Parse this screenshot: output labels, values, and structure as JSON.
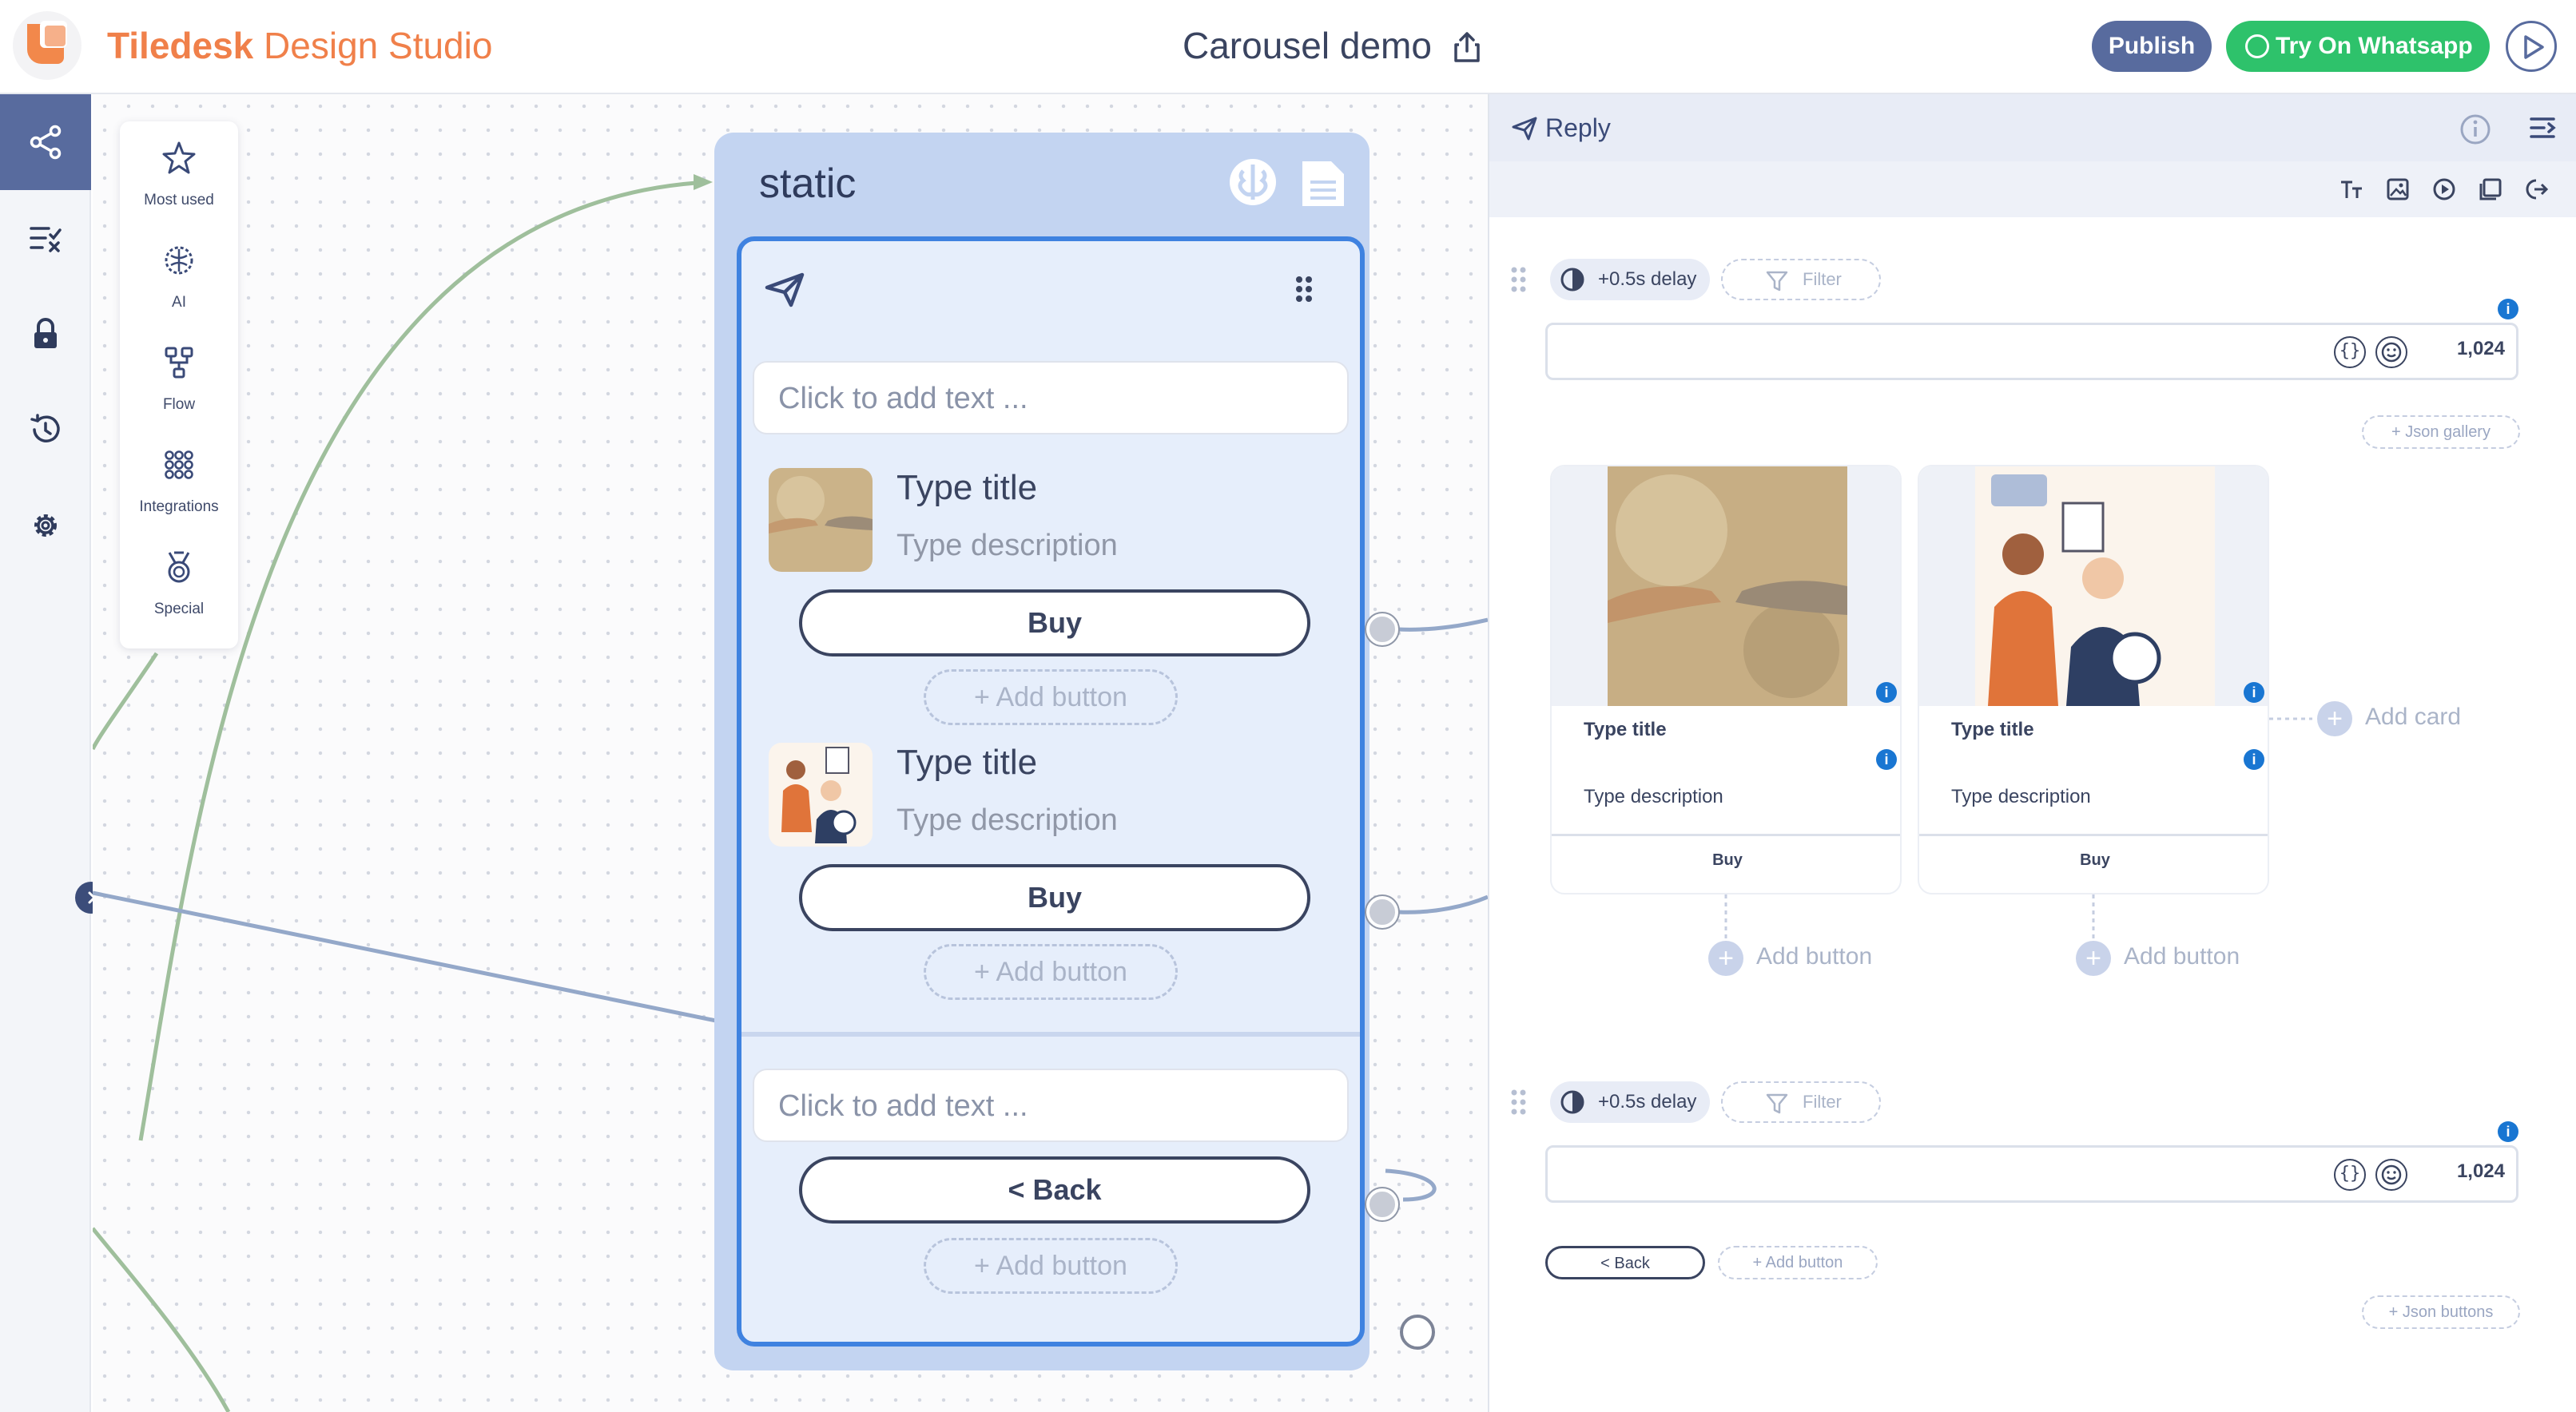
{
  "header": {
    "app_name_bold": "Tiledesk",
    "app_name_rest": " Design Studio",
    "flow_title": "Carousel demo",
    "publish_label": "Publish",
    "whatsapp_label": "Try On Whatsapp"
  },
  "sidebar": {
    "items": [
      {
        "icon": "share-nodes-icon",
        "active": true
      },
      {
        "icon": "checklist-icon",
        "active": false
      },
      {
        "icon": "lock-icon",
        "active": false
      },
      {
        "icon": "history-icon",
        "active": false
      },
      {
        "icon": "gear-icon",
        "active": false
      }
    ]
  },
  "palette": {
    "items": [
      {
        "label": "Most used",
        "icon": "star-icon"
      },
      {
        "label": "AI",
        "icon": "ai-brain-icon"
      },
      {
        "label": "Flow",
        "icon": "flow-icon"
      },
      {
        "label": "Integrations",
        "icon": "integrations-grid-icon"
      },
      {
        "label": "Special",
        "icon": "medal-icon"
      }
    ]
  },
  "block": {
    "title": "static",
    "text_placeholder_1": "Click to add text ...",
    "cards": [
      {
        "title": "Type title",
        "description": "Type description",
        "button": "Buy",
        "add_button": "+ Add button"
      },
      {
        "title": "Type title",
        "description": "Type description",
        "button": "Buy",
        "add_button": "+ Add button"
      }
    ],
    "text_placeholder_2": "Click to add text ...",
    "back_button": "< Back",
    "add_button_3": "+ Add button"
  },
  "right_panel": {
    "title": "Reply",
    "delay_label": "+0.5s delay",
    "filter_label": "Filter",
    "counter": "1,024",
    "json_gallery": "+ Json gallery",
    "gallery_cards": [
      {
        "title": "Type title",
        "description": "Type description",
        "button": "Buy"
      },
      {
        "title": "Type title",
        "description": "Type description",
        "button": "Buy"
      }
    ],
    "add_button_label": "Add button",
    "add_card_label": "Add card",
    "delay_label_2": "+0.5s delay",
    "filter_label_2": "Filter",
    "counter_2": "1,024",
    "back_button": "< Back",
    "add_button_small": "+ Add button",
    "json_buttons": "+ Json buttons",
    "info_glyph": "i"
  },
  "colors": {
    "accent_orange": "#f0804a",
    "primary_blue": "#586b9e",
    "whatsapp_green": "#2ec26b",
    "block_bg": "#c3d4f1",
    "reply_border": "#3f82e0"
  }
}
